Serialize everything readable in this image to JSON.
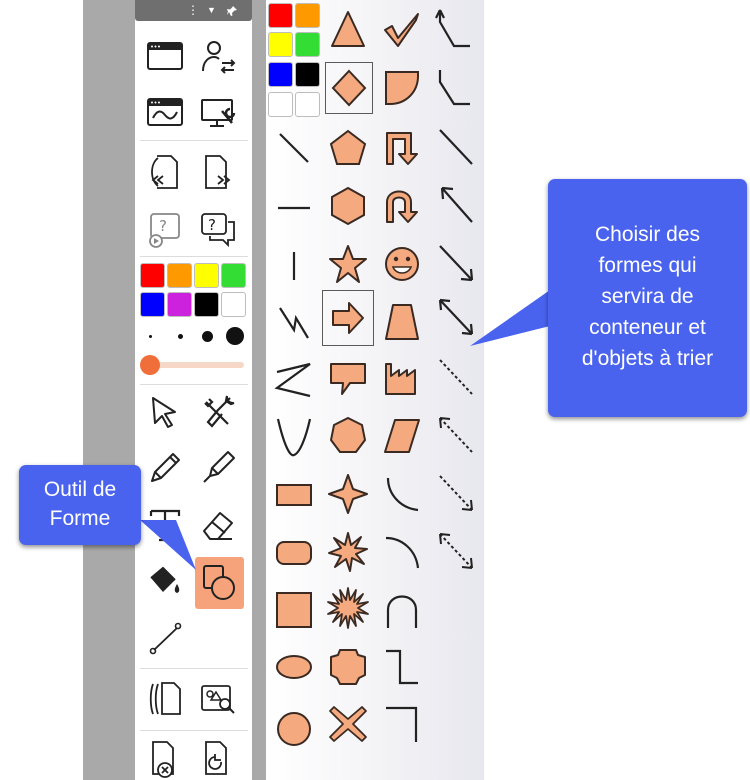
{
  "colors": {
    "shape_fill": "#f4a97f",
    "shape_stroke": "#3a2a22",
    "callout_bg": "#4a63ee",
    "active_tool_bg": "#f6a37b",
    "slider": "#f06e3a"
  },
  "toolbar": {
    "header_icons": [
      "more-icon",
      "dropdown-icon",
      "pin-icon"
    ],
    "palette": [
      "#ff0000",
      "#ff9900",
      "#ffff00",
      "#33dd33",
      "#0000ff",
      "#cc22dd",
      "#000000",
      "#ffffff"
    ],
    "brush_sizes": 4,
    "slider_value": 0,
    "active_tool": "shape-tool"
  },
  "shapes_panel": {
    "palette": [
      "#ff0000",
      "#ff9900",
      "#ffff00",
      "#33dd33",
      "#0000ff",
      "#000000",
      "#ffffff",
      "#ffffff"
    ]
  },
  "callouts": {
    "shape_tool": {
      "lines": [
        "Outil de",
        "Forme"
      ]
    },
    "choose_shapes": {
      "lines": [
        "Choisir des",
        "formes qui",
        "servira de",
        "conteneur et",
        "d'objets à trier"
      ]
    }
  }
}
